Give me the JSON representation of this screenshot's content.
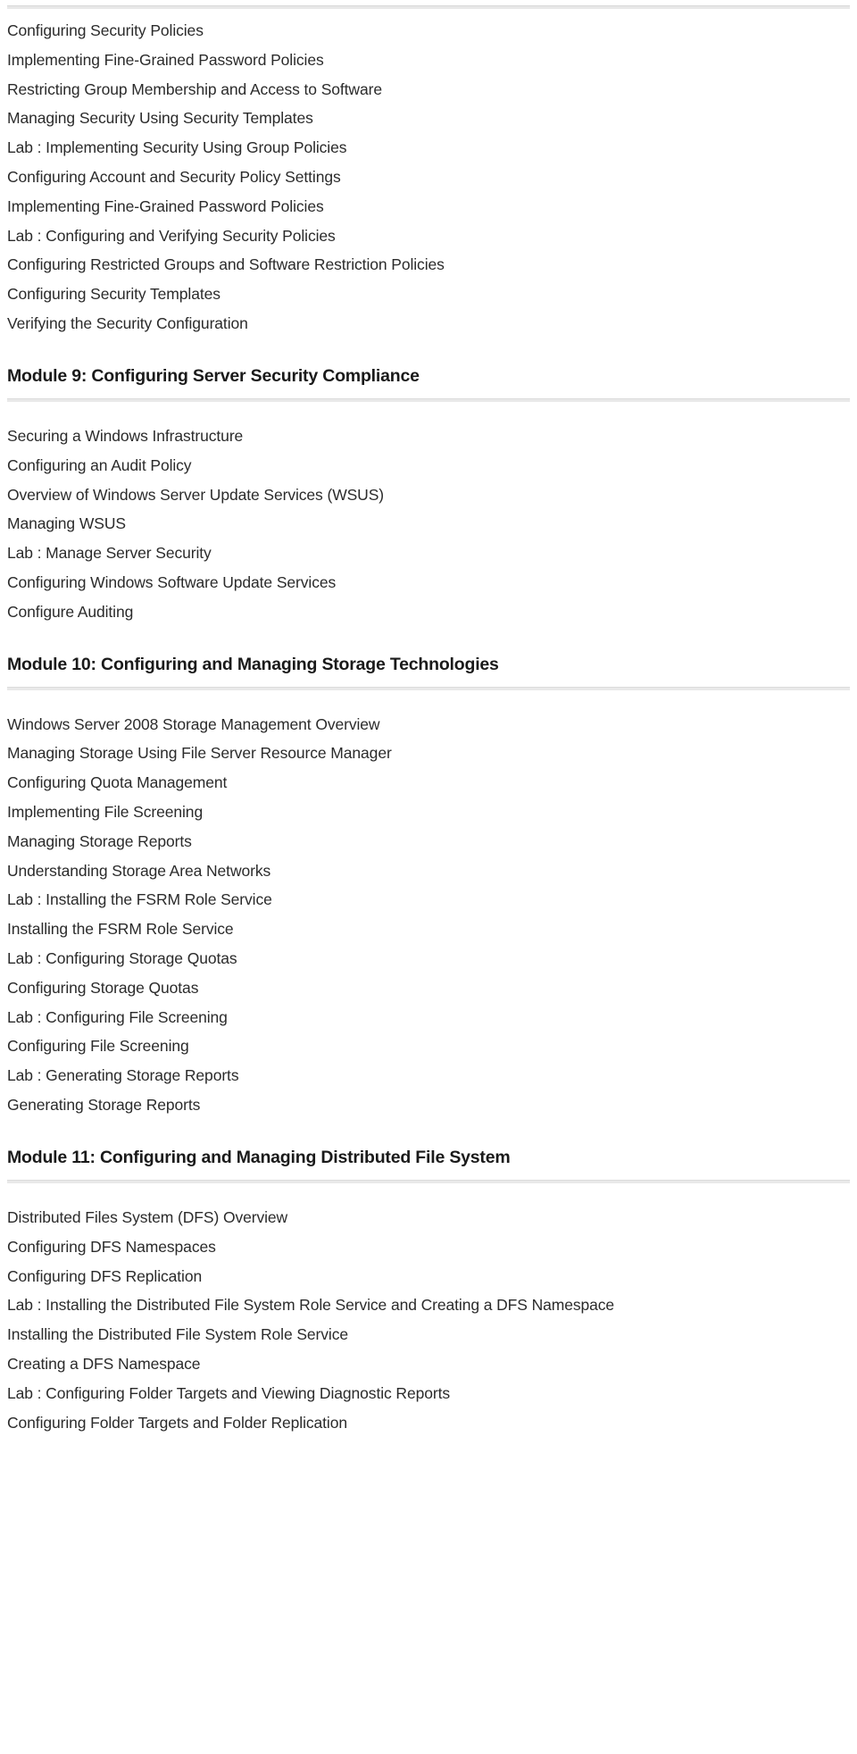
{
  "document": {
    "type": "course-outline",
    "sections": [
      {
        "id": "module-8-continued",
        "heading": null,
        "items": [
          "Configuring Security Policies",
          "Implementing Fine-Grained Password Policies",
          "Restricting Group Membership and Access to Software",
          "Managing Security Using Security Templates",
          "Lab : Implementing Security Using Group Policies",
          "Configuring Account and Security Policy Settings",
          "Implementing Fine-Grained Password Policies",
          "Lab : Configuring and Verifying Security Policies",
          "Configuring Restricted Groups and Software Restriction Policies",
          "Configuring Security Templates",
          "Verifying the Security Configuration"
        ]
      },
      {
        "id": "module-9",
        "heading": "Module 9: Configuring Server Security Compliance",
        "items": [
          "Securing a Windows Infrastructure",
          "Configuring an Audit Policy",
          "Overview of Windows Server Update Services (WSUS)",
          "Managing WSUS",
          "Lab : Manage Server Security",
          "Configuring Windows Software Update Services",
          "Configure Auditing"
        ]
      },
      {
        "id": "module-10",
        "heading": "Module 10: Configuring and Managing Storage Technologies",
        "items": [
          "Windows Server 2008 Storage Management Overview",
          "Managing Storage Using File Server Resource Manager",
          "Configuring Quota Management",
          "Implementing File Screening",
          "Managing Storage Reports",
          "Understanding Storage Area Networks",
          "Lab : Installing the FSRM Role Service",
          "Installing the FSRM Role Service",
          "Lab : Configuring Storage Quotas",
          "Configuring Storage Quotas",
          "Lab : Configuring File Screening",
          "Configuring File Screening",
          "Lab : Generating Storage Reports",
          "Generating Storage Reports"
        ]
      },
      {
        "id": "module-11",
        "heading": "Module 11: Configuring and Managing Distributed File System",
        "items": [
          "Distributed Files System (DFS) Overview",
          "Configuring DFS Namespaces",
          "Configuring DFS Replication",
          "Lab : Installing the Distributed File System Role Service and Creating a DFS Namespace",
          "Installing the Distributed File System Role Service",
          "Creating a DFS Namespace",
          "Lab : Configuring Folder Targets and Viewing Diagnostic Reports",
          "Configuring Folder Targets and Folder Replication"
        ]
      }
    ]
  },
  "colors": {
    "text": "#2b2b2b",
    "heading": "#1a1a1a",
    "rule": "#e9e9e9",
    "background": "#ffffff"
  }
}
